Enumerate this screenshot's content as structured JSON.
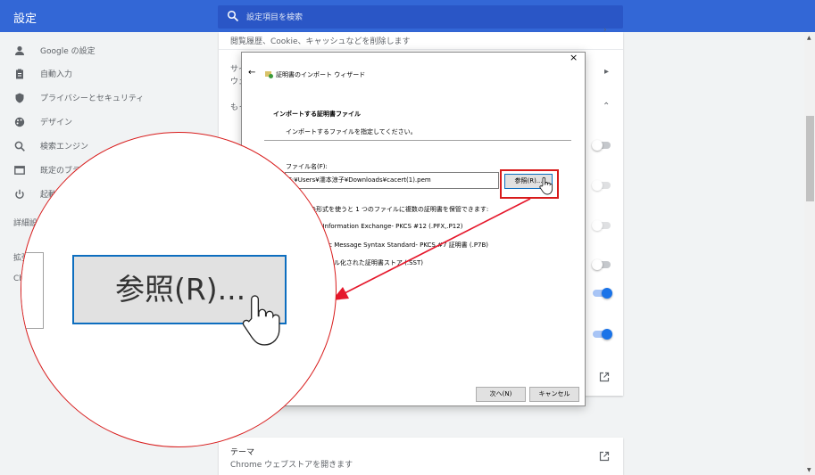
{
  "app": {
    "title": "設定"
  },
  "search": {
    "placeholder": "設定項目を検索"
  },
  "nav": {
    "items": [
      {
        "label": "Google の設定",
        "icon": "person-icon"
      },
      {
        "label": "自動入力",
        "icon": "clipboard-icon"
      },
      {
        "label": "プライバシーとセキュリティ",
        "icon": "shield-icon"
      },
      {
        "label": "デザイン",
        "icon": "palette-icon"
      },
      {
        "label": "検索エンジン",
        "icon": "search-icon"
      },
      {
        "label": "既定のブラウ",
        "icon": "browser-icon"
      },
      {
        "label": "起動時",
        "icon": "power-icon"
      }
    ],
    "advanced": "詳細設",
    "ext": "拡張",
    "chrome": "Ch"
  },
  "content": {
    "clear_data_desc": "閲覧履歴、Cookie、キャッシュなどを削除します",
    "site_label_1": "サイ",
    "site_label_2": "ウェ",
    "more_label": "もっ",
    "theme_title": "テーマ",
    "theme_desc": "Chrome ウェブストアを開きます"
  },
  "dialog": {
    "title": "証明書のインポート ウィザード",
    "heading": "インポートする証明書ファイル",
    "subheading": "インポートするファイルを指定してください。",
    "filename_label": "ファイル名(F):",
    "filename_value": "C:¥Users¥濡本涼子¥Downloads¥cacert(1).pem",
    "browse_label": "参照(R)...",
    "note": "次の形式を使うと 1 つのファイルに複数の証明書を保管できます:",
    "formats": [
      "al Information Exchange- PKCS #12 (.PFX,.P12)",
      "aphic Message Syntax Standard- PKCS #7 証明書 (.P7B)",
      "シリアル化された証明書ストア (.SST)"
    ],
    "next_label": "次へ(N)",
    "cancel_label": "キャンセル",
    "close_glyph": "×",
    "back_glyph": "←"
  },
  "magnifier": {
    "browse_label": "参照(R)..."
  },
  "colors": {
    "accent": "#3367d6",
    "highlight": "#d81b1b",
    "toggle_on": "#1a73e8"
  }
}
